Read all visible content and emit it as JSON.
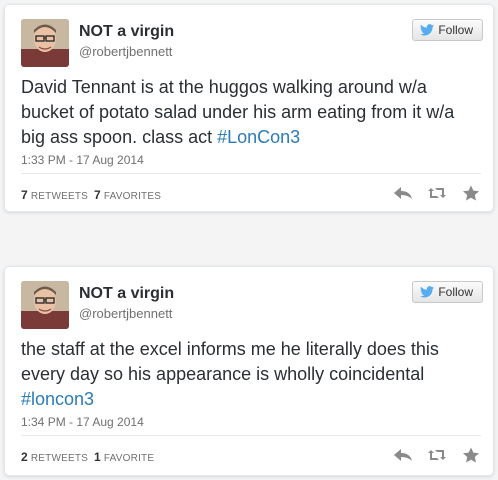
{
  "colors": {
    "hashtag": "#2b7bb9",
    "twitter_bird": "#55acee",
    "icon_gray": "#8a8a8a"
  },
  "tweets": [
    {
      "display_name": "NOT a virgin",
      "handle": "@robertjbennett",
      "follow_label": "Follow",
      "text": "David Tennant is at the huggos walking around w/a bucket of potato salad under his arm eating from it w/a big ass spoon. class act ",
      "hashtag": "#LonCon3",
      "timestamp": "1:33 PM - 17 Aug 2014",
      "retweet_count": "7",
      "retweet_label": "Retweets",
      "favorite_count": "7",
      "favorite_label": "Favorites",
      "icons": [
        "reply-icon",
        "retweet-icon",
        "favorite-icon"
      ]
    },
    {
      "display_name": "NOT a virgin",
      "handle": "@robertjbennett",
      "follow_label": "Follow",
      "text": "the staff at the excel informs me he literally does this every day so his appearance is wholly coincidental ",
      "hashtag": "#loncon3",
      "timestamp": "1:34 PM - 17 Aug 2014",
      "retweet_count": "2",
      "retweet_label": "Retweets",
      "favorite_count": "1",
      "favorite_label": "Favorite",
      "icons": [
        "reply-icon",
        "retweet-icon",
        "favorite-icon"
      ]
    }
  ]
}
